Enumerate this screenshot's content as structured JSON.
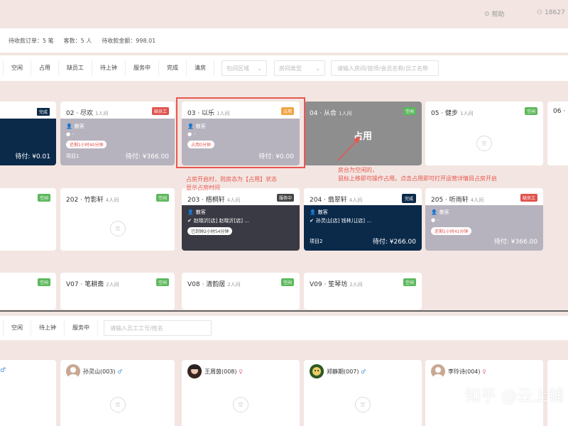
{
  "topbar": {
    "help": "帮助",
    "user": "18627"
  },
  "stats": {
    "pending_orders": "待收款订单：5 笔",
    "guests": "客数：5 人",
    "pending_amount": "待收款金额：998.01"
  },
  "room_filter": {
    "buttons": [
      "空闲",
      "占用",
      "缺员工",
      "待上钟",
      "服务中",
      "完成",
      "清房"
    ],
    "area_placeholder": "包间区域",
    "type_placeholder": "房间类型",
    "search_placeholder": "请输入房间/技师/会员名称/员工名称"
  },
  "rooms_row1": [
    {
      "name": "",
      "capacity": "",
      "badge": "完成",
      "due": "待付: ¥0.01"
    },
    {
      "name": "02 · 尽欢",
      "capacity": "1人间",
      "badge": "缺员工",
      "customer": "散客",
      "dash": "-",
      "pill": "还剩1小时40分钟",
      "project": "项目1",
      "due": "待付: ¥366.00"
    },
    {
      "name": "03 · 以乐",
      "capacity": "1人间",
      "badge": "占用",
      "customer": "散客",
      "dash": "-",
      "pill": "占用0分钟",
      "due": "待付: ¥0.00"
    },
    {
      "name": "04 · 从合",
      "capacity": "1人间",
      "badge": "空闲",
      "overlay_label": "占用"
    },
    {
      "name": "05 · 健步",
      "capacity": "1人间",
      "badge": "空闲"
    },
    {
      "name": "06 ·",
      "capacity": ""
    }
  ],
  "rooms_row2": [
    {
      "name": "",
      "badge": "空闲"
    },
    {
      "name": "202 · 竹影轩",
      "capacity": "4人间",
      "badge": "空闲"
    },
    {
      "name": "203 · 梧桐轩",
      "capacity": "4人间",
      "badge": "服务中",
      "customer": "散客",
      "techs": "赵晓沂[店]   赵晓沂[店] ...",
      "pill": "已到钟2小时54分钟"
    },
    {
      "name": "204 · 翡翠轩",
      "capacity": "4人间",
      "badge": "完成",
      "customer": "散客",
      "techs": "孙灵山[店]   钱林儿[店] ...",
      "project": "项目2",
      "due": "待付: ¥266.00"
    },
    {
      "name": "205 · 听雨轩",
      "capacity": "4人间",
      "badge": "缺员工",
      "customer": "散客",
      "dash": "-",
      "pill": "还剩1小时41分钟",
      "due": "待付: ¥366.00"
    }
  ],
  "rooms_row3": [
    {
      "name": "",
      "badge": "空闲"
    },
    {
      "name": "V07 · 笔耕斋",
      "capacity": "2人间",
      "badge": "空闲"
    },
    {
      "name": "V08 · 清韵居",
      "capacity": "2人间",
      "badge": "空闲"
    },
    {
      "name": "V09 · 笙琴坊",
      "capacity": "2人间",
      "badge": "空闲"
    }
  ],
  "annotations": {
    "note1_line1": "占房开启时，则房态为【占用】状态",
    "note1_line2": "显示占房时间",
    "note2_line1": "房台为空闲的，",
    "note2_line2": "鼠标上移即可操作占用。点击占用即可打开运营详情目占房开启"
  },
  "staff_filter": {
    "buttons": [
      "空闲",
      "待上钟",
      "服务中"
    ],
    "search_placeholder": "请输入员工工号/姓名"
  },
  "staff": [
    {
      "name": "孙灵山(003)",
      "gender": "♂"
    },
    {
      "name": "王周茵(008)",
      "gender": "♀"
    },
    {
      "name": "郑静期(007)",
      "gender": "♂"
    },
    {
      "name": "李玲诗(004)",
      "gender": "♀"
    }
  ],
  "empty_icon_text": "空",
  "watermark": "知乎 @云上铺",
  "colors": {
    "navy": "#0b2a4a",
    "grey": "#b6b3be",
    "dark": "#3a3a44",
    "green": "#5cb85c",
    "red": "#e0534d",
    "orange": "#f0a443"
  }
}
